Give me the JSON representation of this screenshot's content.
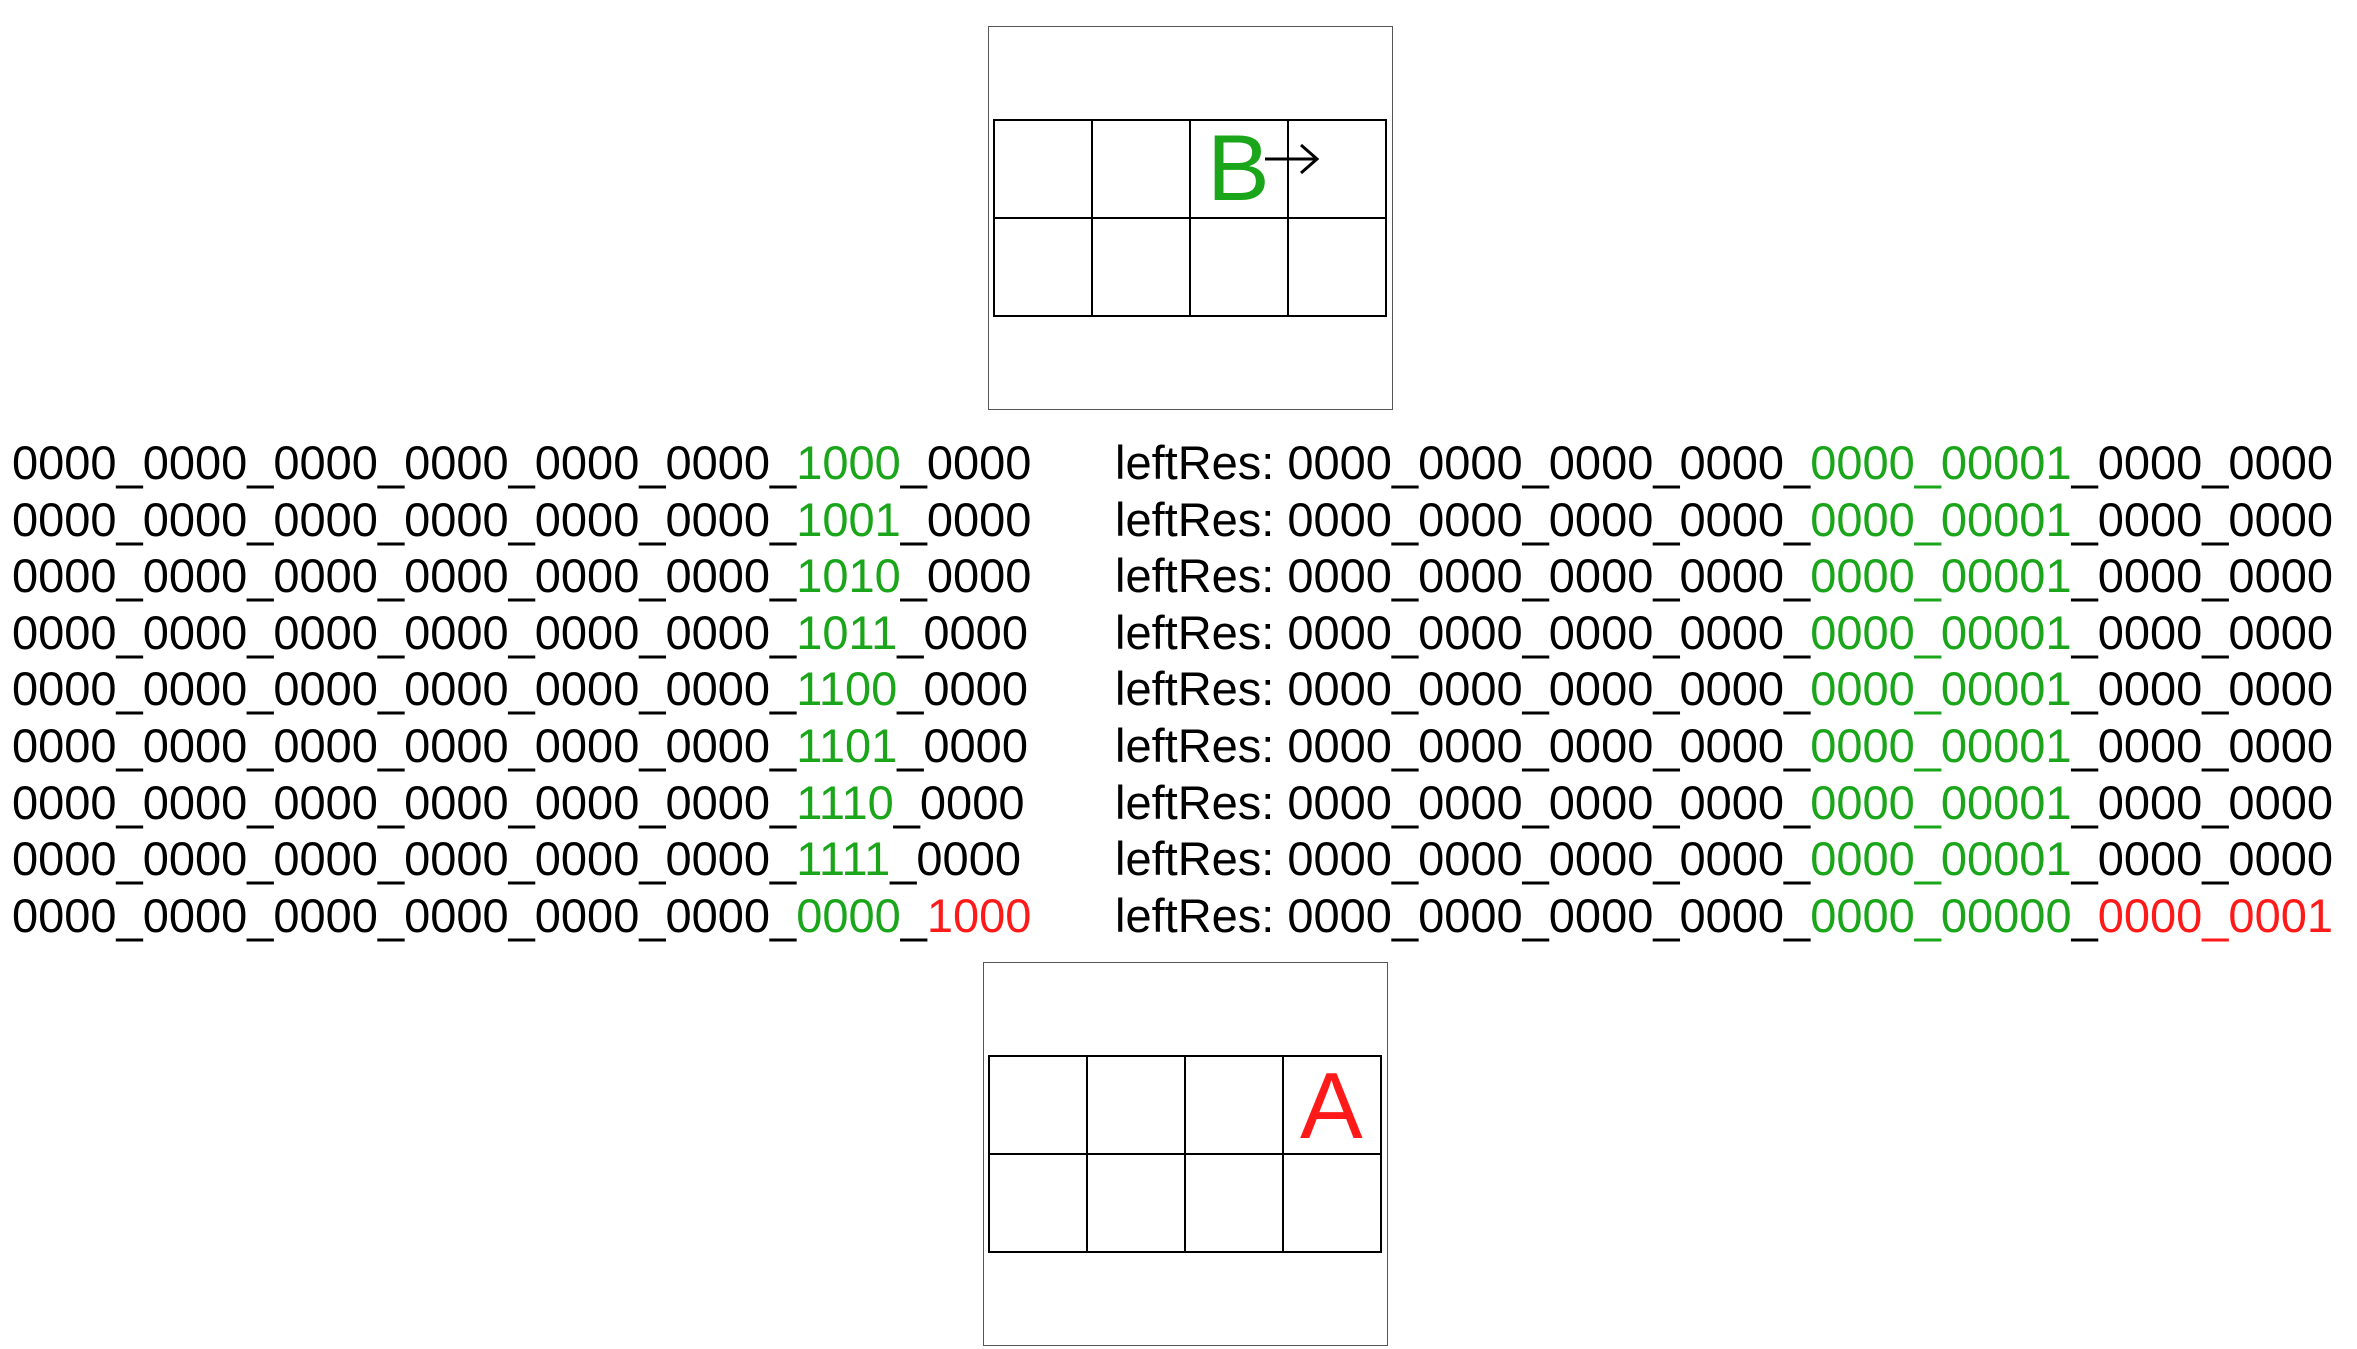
{
  "colors": {
    "highlight": "#1aa51a",
    "alert": "#ff1a1a",
    "text": "#000000"
  },
  "top_board": {
    "piece_label": "B",
    "piece_color": "#1aa51a",
    "direction": "right-arrow-icon",
    "piece_cell": {
      "row": 1,
      "col": 3
    }
  },
  "bottom_board": {
    "piece_label": "A",
    "piece_color": "#ff1a1a",
    "piece_cell": {
      "row": 1,
      "col": 4
    }
  },
  "left_lines": [
    {
      "black": "0000_0000_0000_0000_0000_0000_",
      "green": "1000",
      "tail": "_0000",
      "tail_color": "black"
    },
    {
      "black": "0000_0000_0000_0000_0000_0000_",
      "green": "1001",
      "tail": "_0000",
      "tail_color": "black"
    },
    {
      "black": "0000_0000_0000_0000_0000_0000_",
      "green": "1010",
      "tail": "_0000",
      "tail_color": "black"
    },
    {
      "black": "0000_0000_0000_0000_0000_0000_",
      "green": "1011",
      "tail": "_0000",
      "tail_color": "black"
    },
    {
      "black": "0000_0000_0000_0000_0000_0000_",
      "green": "1100",
      "tail": "_0000",
      "tail_color": "black"
    },
    {
      "black": "0000_0000_0000_0000_0000_0000_",
      "green": "1101",
      "tail": "_0000",
      "tail_color": "black"
    },
    {
      "black": "0000_0000_0000_0000_0000_0000_",
      "green": "1110",
      "tail": "_0000",
      "tail_color": "black"
    },
    {
      "black": "0000_0000_0000_0000_0000_0000_",
      "green": "1111",
      "tail": "_0000",
      "tail_color": "black"
    },
    {
      "black": "0000_0000_0000_0000_0000_0000_",
      "green": "0000",
      "sep": "_",
      "red": "1000"
    }
  ],
  "right_lines": [
    {
      "prefix": "leftRes: 0000_0000_0000_0000_",
      "green": "0000_00001",
      "tail": "_0000_0000"
    },
    {
      "prefix": "leftRes: 0000_0000_0000_0000_",
      "green": "0000_00001",
      "tail": "_0000_0000"
    },
    {
      "prefix": "leftRes: 0000_0000_0000_0000_",
      "green": "0000_00001",
      "tail": "_0000_0000"
    },
    {
      "prefix": "leftRes: 0000_0000_0000_0000_",
      "green": "0000_00001",
      "tail": "_0000_0000"
    },
    {
      "prefix": "leftRes: 0000_0000_0000_0000_",
      "green": "0000_00001",
      "tail": "_0000_0000"
    },
    {
      "prefix": "leftRes: 0000_0000_0000_0000_",
      "green": "0000_00001",
      "tail": "_0000_0000"
    },
    {
      "prefix": "leftRes: 0000_0000_0000_0000_",
      "green": "0000_00001",
      "tail": "_0000_0000"
    },
    {
      "prefix": "leftRes: 0000_0000_0000_0000_",
      "green": "0000_00001",
      "tail": "_0000_0000"
    },
    {
      "prefix": "leftRes: 0000_0000_0000_0000_",
      "green": "0000_00000",
      "sep": "_",
      "red": "0000_0001"
    }
  ]
}
